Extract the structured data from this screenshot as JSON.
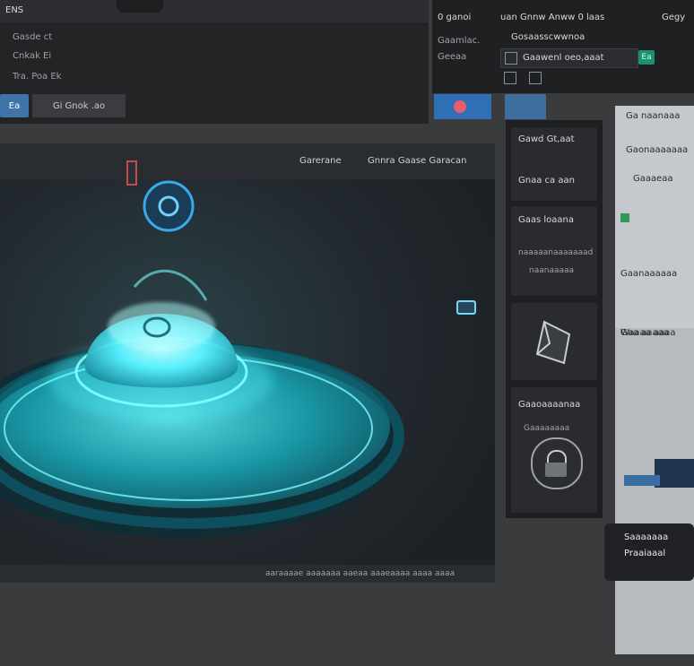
{
  "top_left": {
    "title": "ENS",
    "rows": [
      "Gasde ct",
      "Cnkak Ei",
      "Tra. Poa Ek"
    ],
    "buttons": {
      "primary": "Ea",
      "secondary": "Gi Gnok .ao"
    }
  },
  "right_top": {
    "header": [
      "0 ganoi",
      "uan Gnnw Anww 0 laas",
      "Gegy"
    ],
    "row1_label": "Gaamlac.",
    "row1_value": "Gosaasscwwnoa",
    "row2_label": "Geeaa",
    "row2_value": "Gaawenl oeo,aaat",
    "row2_badge": "Ea"
  },
  "viewport": {
    "header_labels": [
      "Garerane",
      "Gnnra Gaase Garacan"
    ],
    "footer_text": "aaraaaae aaaaaaa aaeaa aaaeaaaa aaaa aaaa"
  },
  "mid_sidebar": {
    "items": [
      {
        "label": "Gawd Gt,aat"
      },
      {
        "label": "Gnaa ca aan"
      },
      {
        "label": "Gaas loaana"
      },
      {
        "label": "naaaaanaaaaaaad"
      },
      {
        "label": "naanaaaaa"
      },
      {
        "label": "Gaaoaaaanaa"
      },
      {
        "label": "Gaaaaaaaa"
      }
    ]
  },
  "right_panel": {
    "lines": [
      "Ga naanaaa",
      "Gaonaaaaaaa",
      "Gaaaeaa",
      "Gaanaaaaaa",
      "Gaa aaaaa",
      "Waaaa aaaa",
      "Saaaaaaa",
      "Praaiaaal"
    ]
  },
  "colors": {
    "accent_blue": "#3f74a8",
    "cyan_glow": "#38e3f0",
    "panel_dark": "#1e1f21",
    "panel_light": "#c5c8cc"
  },
  "icons": {
    "rt_doc": "document-icon",
    "rt_folder": "folder-icon",
    "mid_shape": "shape-icon",
    "mid_lock": "lock-icon",
    "vp_target": "target-icon",
    "vp_cam": "camera-icon"
  }
}
